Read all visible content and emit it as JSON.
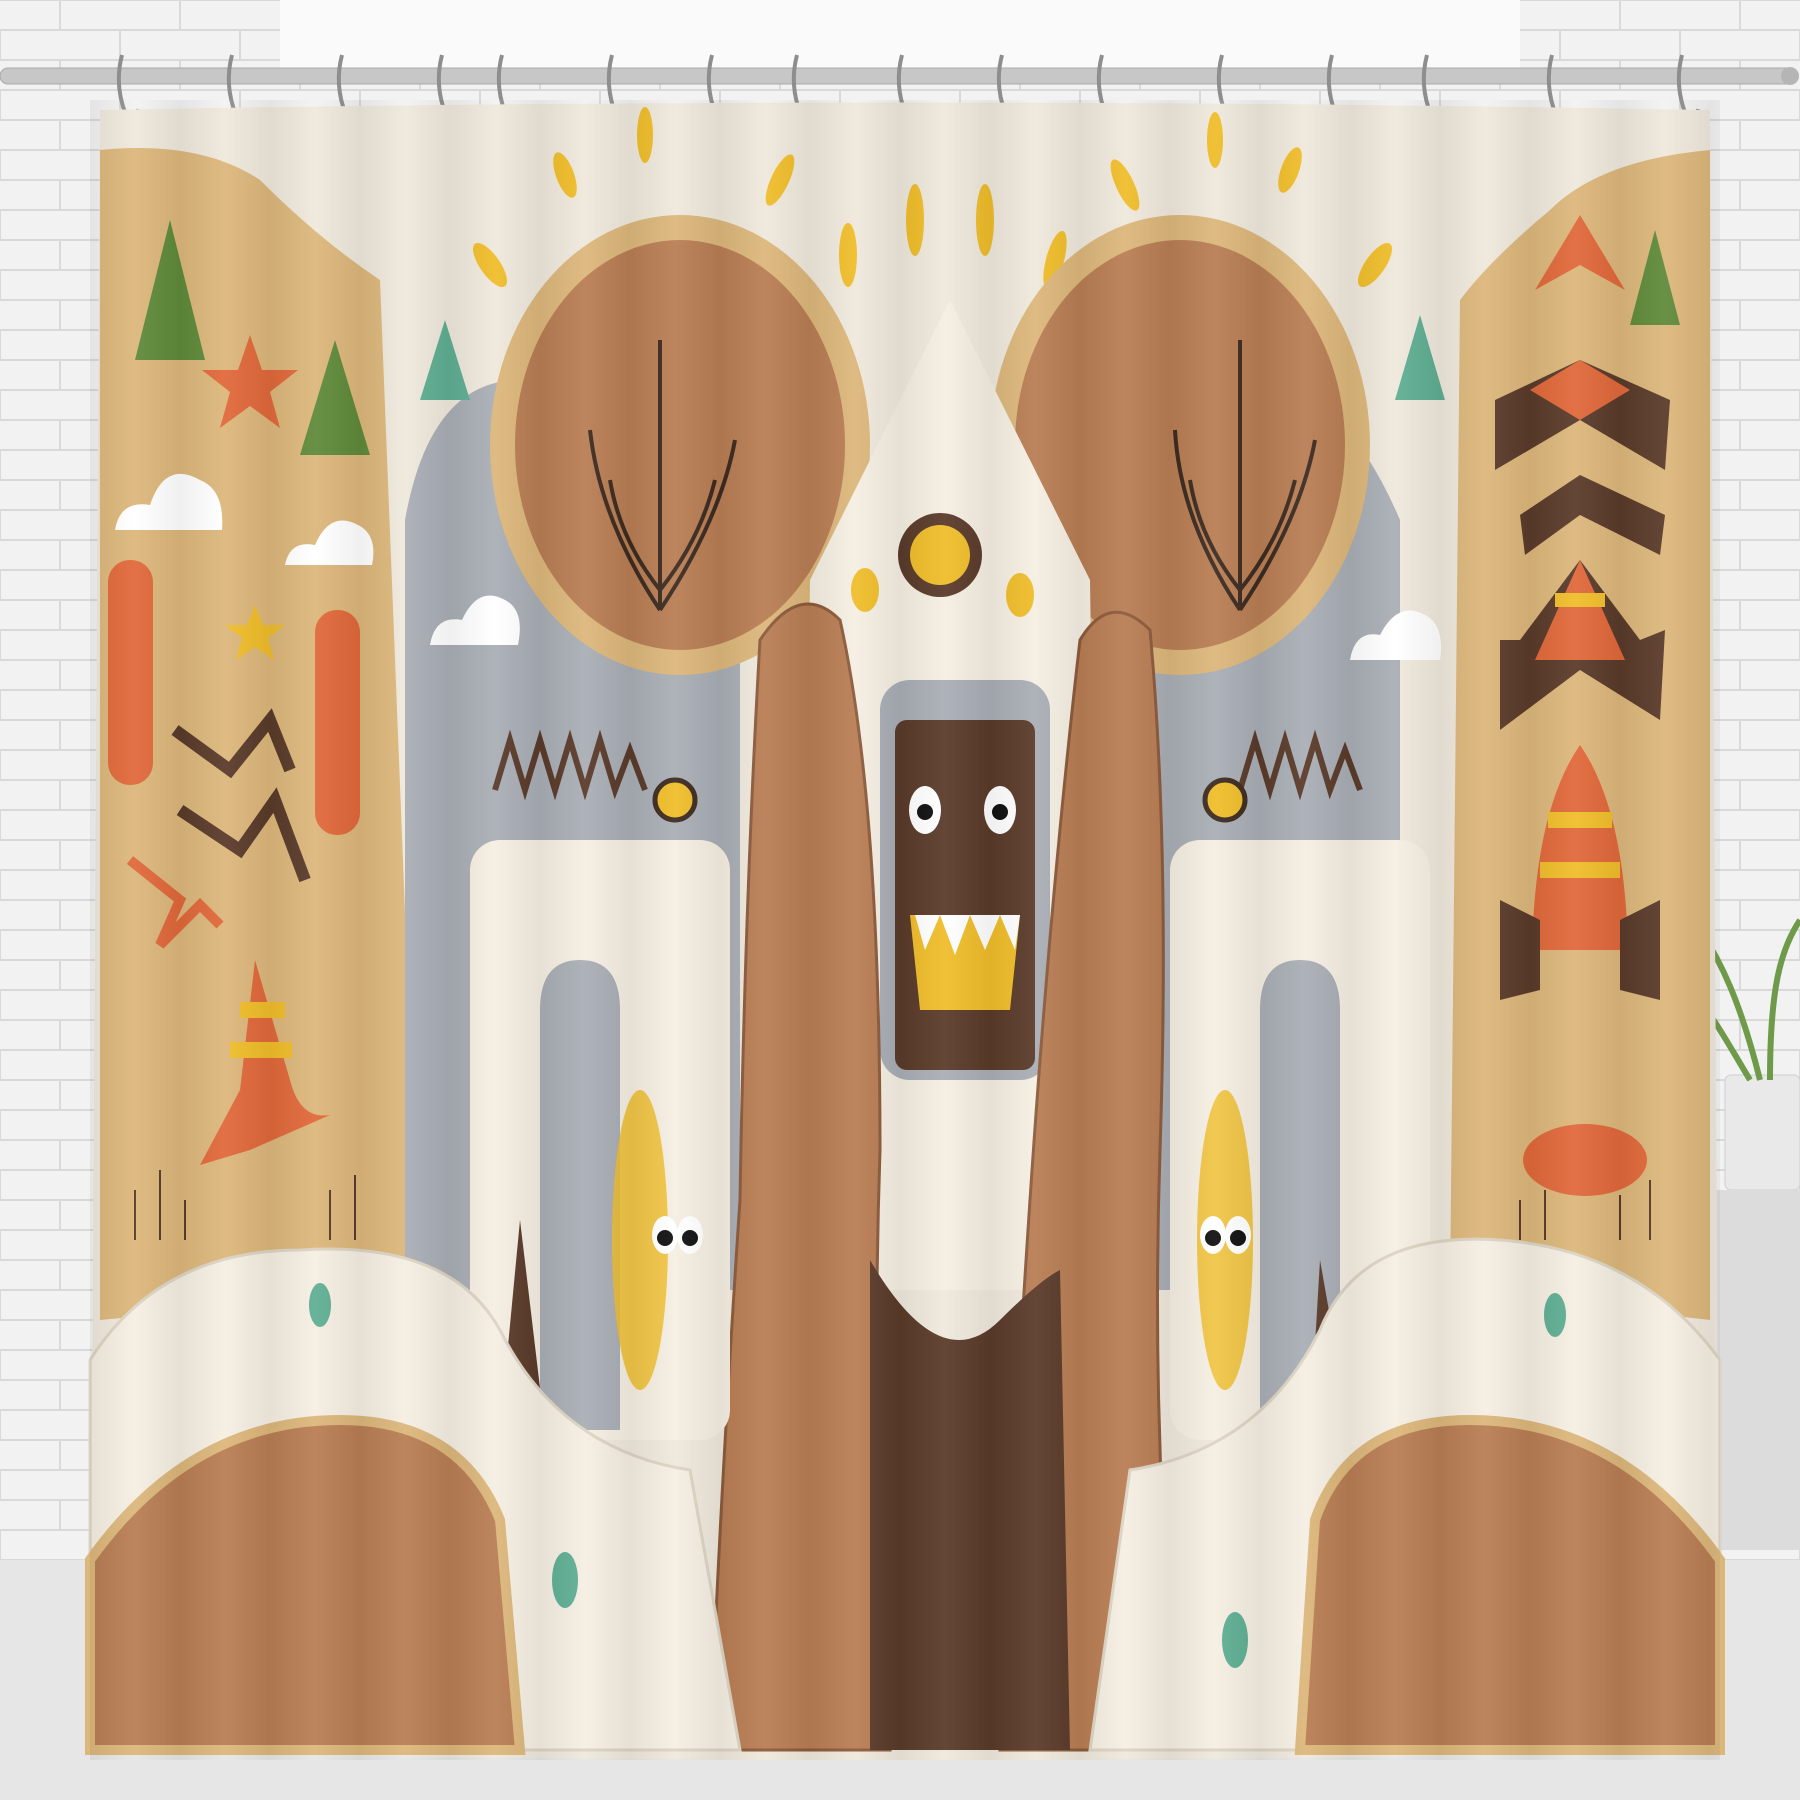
{
  "scene": {
    "subject": "shower-curtain",
    "colors": {
      "wall": "#f2f2f2",
      "brick_line": "#d9d9d9",
      "rod": "#c9c9c9",
      "curtain_base": "#efe9dc",
      "tan": "#dcb77a",
      "brown": "#b97d53",
      "dark_brown": "#5a3a2a",
      "grey": "#a9adb5",
      "cream": "#f4eee2",
      "orange": "#e0683a",
      "yellow": "#efbd2a",
      "green": "#5f8a3a",
      "teal": "#5fae93"
    }
  }
}
